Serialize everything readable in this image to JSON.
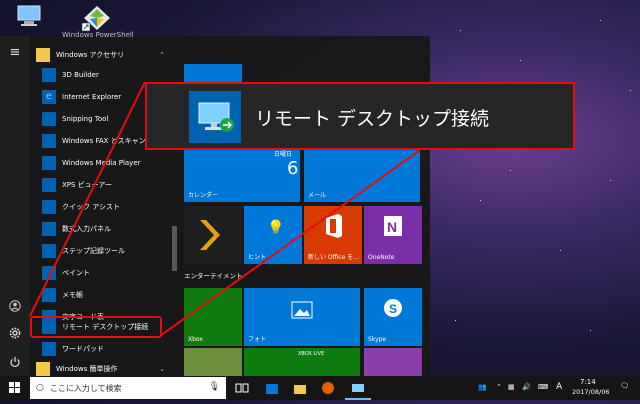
{
  "colors": {
    "accent": "#0063b1",
    "highlight_red": "#e01010",
    "tile_blue": "#0078d7",
    "tile_purple": "#7a2fa8",
    "tile_red": "#d83b01",
    "tile_green": "#107c10"
  },
  "desktop_icons": [
    {
      "name": "this-pc-icon"
    },
    {
      "name": "shortcut-icon"
    }
  ],
  "start_menu": {
    "rail": {
      "hamburger": "≡",
      "user": "user-icon",
      "settings": "settings-icon",
      "power": "power-icon"
    },
    "app_list": {
      "top_partial": "Windows PowerShell",
      "folder": "Windows アクセサリ",
      "apps": [
        "3D Builder",
        "Internet Explorer",
        "Snipping Tool",
        "Windows FAX とスキャン",
        "Windows Media Player",
        "XPS ビューアー",
        "クイック アシスト",
        "数式入力パネル",
        "ステップ記録ツール",
        "ペイント",
        "メモ帳",
        "文字コード表",
        "リモート デスクトップ接続",
        "ワードパッド"
      ],
      "bottom_folder": "Windows 簡単操作"
    },
    "tiles": {
      "calendar_day_name": "日曜日",
      "calendar_day": "6",
      "calendar_label": "カレンダー",
      "mail_label": "メール",
      "hint_label": "ヒント",
      "office_label": "新しい Office を...",
      "onenote_label": "OneNote",
      "entertainment_label": "エンターテイメント",
      "xbox_label": "Xbox",
      "photos_label": "フォト",
      "skype_label": "Skype",
      "xbox_live_label": "XBOX LIVE"
    }
  },
  "callout": {
    "label": "リモート デスクトップ接続"
  },
  "taskbar": {
    "search_placeholder": "ここに入力して検索",
    "ime": "A",
    "time": "7:14",
    "date": "2017/08/06"
  }
}
